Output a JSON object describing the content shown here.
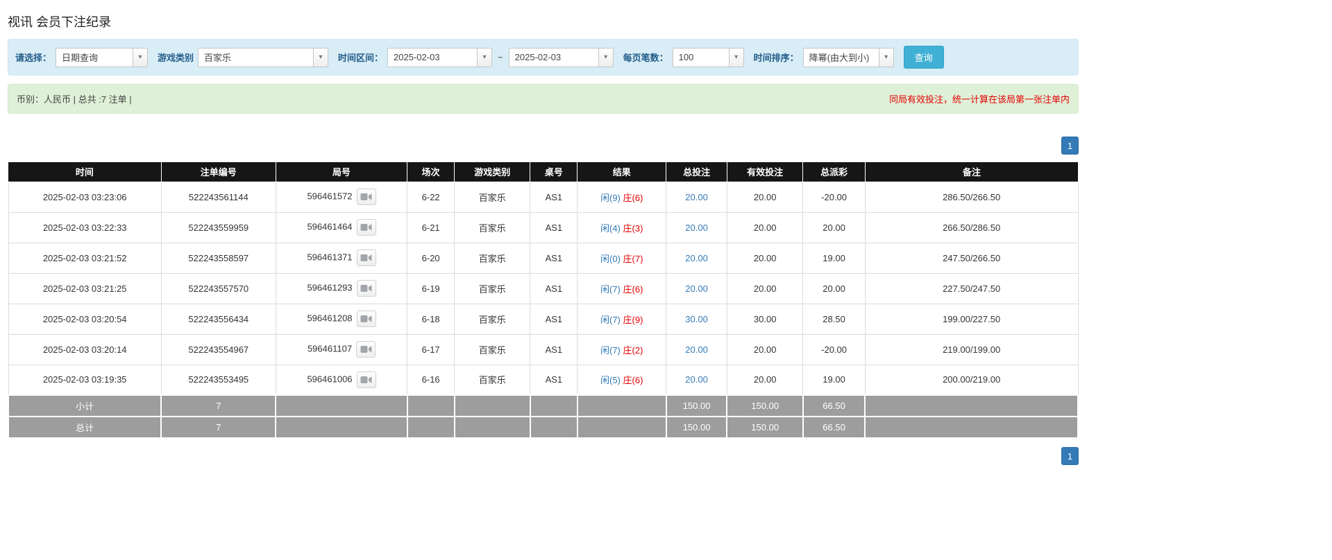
{
  "page": {
    "title": "视讯 会员下注纪录"
  },
  "filters": {
    "select_label": "请选择：",
    "select_value": "日期查询",
    "game_type_label": "游戏类别",
    "game_type_value": "百家乐",
    "date_range_label": "时间区间：",
    "date_from": "2025-02-03",
    "date_separator": "~",
    "date_to": "2025-02-03",
    "page_size_label": "每页笔数：",
    "page_size_value": "100",
    "sort_label": "时间排序：",
    "sort_value": "降幂(由大到小)",
    "search_button": "查询",
    "accent_color": "#41b0d5"
  },
  "info_bar": {
    "left": "币别：人民币 | 总共 :7 注单 |",
    "right": "同局有效投注，统一计算在该局第一张注单内"
  },
  "pagination": {
    "current_page": "1"
  },
  "table": {
    "headers": [
      "时间",
      "注单编号",
      "局号",
      "场次",
      "游戏类别",
      "桌号",
      "结果",
      "总投注",
      "有效投注",
      "总派彩",
      "备注"
    ],
    "rows": [
      {
        "time": "2025-02-03 03:23:06",
        "bet_id": "522243561144",
        "round_id": "596461572",
        "session": "6-22",
        "game_type": "百家乐",
        "table_id": "AS1",
        "result_player": "闲(9)",
        "result_banker": "庄(6)",
        "total_bet": "20.00",
        "valid_bet": "20.00",
        "payout": "-20.00",
        "note": "286.50/266.50"
      },
      {
        "time": "2025-02-03 03:22:33",
        "bet_id": "522243559959",
        "round_id": "596461464",
        "session": "6-21",
        "game_type": "百家乐",
        "table_id": "AS1",
        "result_player": "闲(4)",
        "result_banker": "庄(3)",
        "total_bet": "20.00",
        "valid_bet": "20.00",
        "payout": "20.00",
        "note": "266.50/286.50"
      },
      {
        "time": "2025-02-03 03:21:52",
        "bet_id": "522243558597",
        "round_id": "596461371",
        "session": "6-20",
        "game_type": "百家乐",
        "table_id": "AS1",
        "result_player": "闲(0)",
        "result_banker": "庄(7)",
        "total_bet": "20.00",
        "valid_bet": "20.00",
        "payout": "19.00",
        "note": "247.50/266.50"
      },
      {
        "time": "2025-02-03 03:21:25",
        "bet_id": "522243557570",
        "round_id": "596461293",
        "session": "6-19",
        "game_type": "百家乐",
        "table_id": "AS1",
        "result_player": "闲(7)",
        "result_banker": "庄(6)",
        "total_bet": "20.00",
        "valid_bet": "20.00",
        "payout": "20.00",
        "note": "227.50/247.50"
      },
      {
        "time": "2025-02-03 03:20:54",
        "bet_id": "522243556434",
        "round_id": "596461208",
        "session": "6-18",
        "game_type": "百家乐",
        "table_id": "AS1",
        "result_player": "闲(7)",
        "result_banker": "庄(9)",
        "total_bet": "30.00",
        "valid_bet": "30.00",
        "payout": "28.50",
        "note": "199.00/227.50"
      },
      {
        "time": "2025-02-03 03:20:14",
        "bet_id": "522243554967",
        "round_id": "596461107",
        "session": "6-17",
        "game_type": "百家乐",
        "table_id": "AS1",
        "result_player": "闲(7)",
        "result_banker": "庄(2)",
        "total_bet": "20.00",
        "valid_bet": "20.00",
        "payout": "-20.00",
        "note": "219.00/199.00"
      },
      {
        "time": "2025-02-03 03:19:35",
        "bet_id": "522243553495",
        "round_id": "596461006",
        "session": "6-16",
        "game_type": "百家乐",
        "table_id": "AS1",
        "result_player": "闲(5)",
        "result_banker": "庄(6)",
        "total_bet": "20.00",
        "valid_bet": "20.00",
        "payout": "19.00",
        "note": "200.00/219.00"
      }
    ],
    "subtotal": {
      "label": "小计",
      "count": "7",
      "total_bet": "150.00",
      "valid_bet": "150.00",
      "payout": "66.50"
    },
    "total": {
      "label": "总计",
      "count": "7",
      "total_bet": "150.00",
      "valid_bet": "150.00",
      "payout": "66.50"
    }
  }
}
